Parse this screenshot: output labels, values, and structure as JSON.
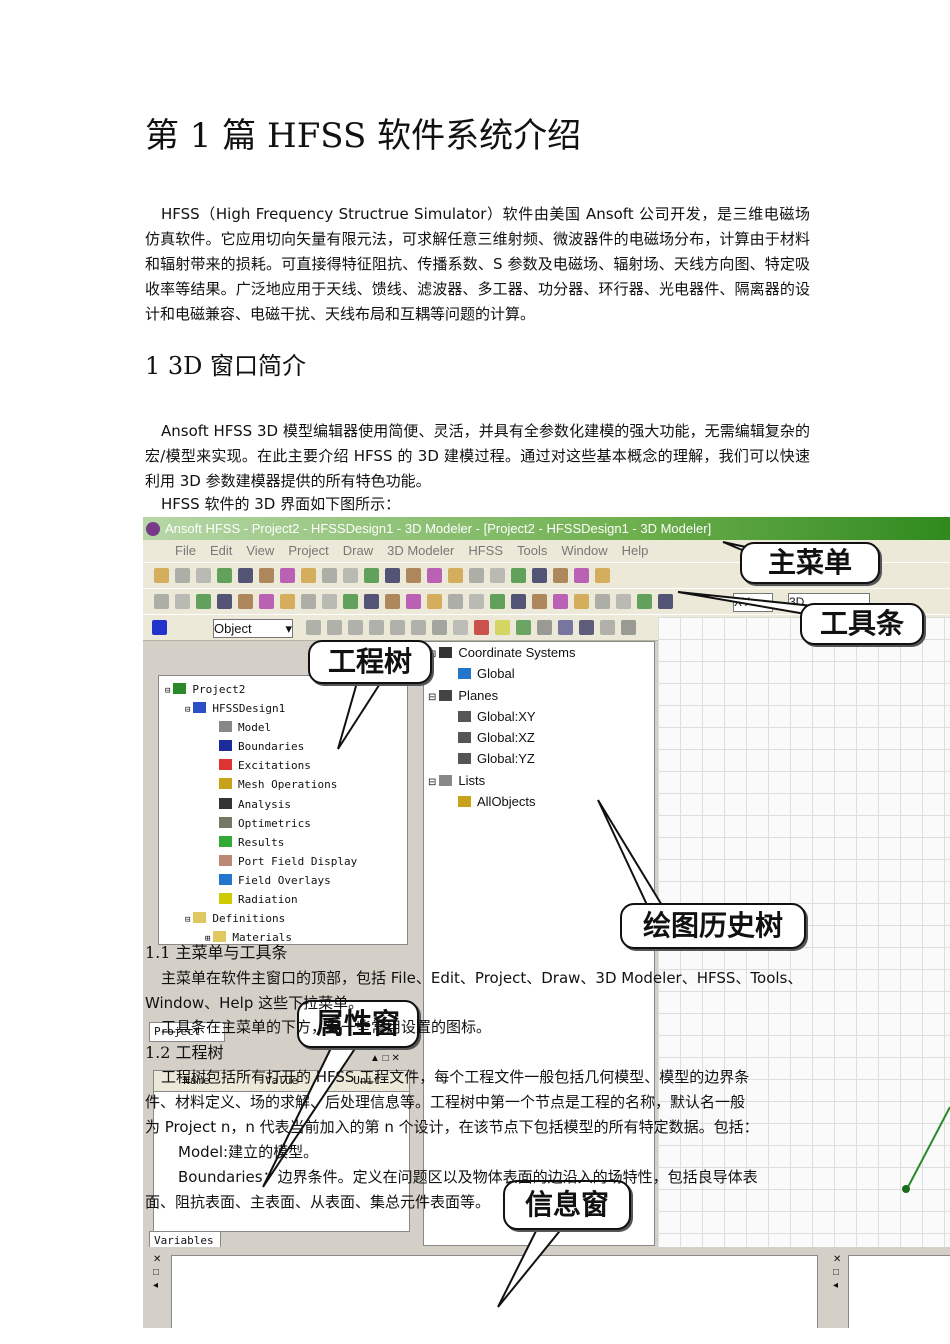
{
  "doc": {
    "title": "第 1 篇  HFSS 软件系统介绍",
    "intro": "HFSS（High Frequency Structrue Simulator）软件由美国 Ansoft 公司开发，是三维电磁场仿真软件。它应用切向矢量有限元法，可求解任意三维射频、微波器件的电磁场分布，计算由于材料和辐射带来的损耗。可直接得特征阻抗、传播系数、S 参数及电磁场、辐射场、天线方向图、特定吸收率等结果。广泛地应用于天线、馈线、滤波器、多工器、功分器、环行器、光电器件、隔离器的设计和电磁兼容、电磁干扰、天线布局和互耦等问题的计算。",
    "section1": "1 3D 窗口简介",
    "section1_para": "Ansoft HFSS 3D 模型编辑器使用简便、灵活，并具有全参数化建模的强大功能，无需编辑复杂的宏/模型来实现。在此主要介绍 HFSS 的 3D 建模过程。通过对这些基本概念的理解，我们可以快速利用 3D 参数建模器提供的所有特色功能。",
    "section1_line2": "HFSS 软件的 3D 界面如下图所示：",
    "sub11": "1.1  主菜单与工具条",
    "sub11_l1": "主菜单在软件主窗口的顶部，包括 File、Edit、Project、Draw、3D Modeler、HFSS、Tools、",
    "sub11_l2": "Window、Help 这些下拉菜单。",
    "sub11_l3": "工具条在主菜单的下方，是一些常用设置的图标。",
    "sub12": "1.2  工程树",
    "sub12_l1": "工程树包括所有打开的 HFSS 工程文件，每个工程文件一般包括几何模型、模型的边界条",
    "sub12_l2": "件、材料定义、场的求解、后处理信息等。工程树中第一个节点是工程的名称，默认名一般",
    "sub12_l3": "为 Project n，n 代表当前加入的第 n 个设计，在该节点下包括模型的所有特定数据。包括：",
    "sub12_l4": "Model:建立的模型。",
    "sub12_l5": "Boundaries：边界条件。定义在问题区以及物体表面的边沿入的场特性，包括良导体表",
    "sub12_l6": "面、阻抗表面、主表面、从表面、集总元件表面等。"
  },
  "app": {
    "window_title": "Ansoft HFSS - Project2 - HFSSDesign1 - 3D Modeler - [Project2 - HFSSDesign1 - 3D Modeler]",
    "menu": [
      "File",
      "Edit",
      "View",
      "Project",
      "Draw",
      "3D Modeler",
      "HFSS",
      "Tools",
      "Window",
      "Help"
    ],
    "select_mode": "Object",
    "plane_select": "XY",
    "view_select": "3D",
    "project_tree": [
      "Project2",
      "HFSSDesign1",
      "Model",
      "Boundaries",
      "Excitations",
      "Mesh Operations",
      "Analysis",
      "Optimetrics",
      "Results",
      "Port Field Display",
      "Field Overlays",
      "Radiation",
      "Definitions",
      "Materials"
    ],
    "history_tree": [
      "Coordinate Systems",
      "Global",
      "Planes",
      "Global:XY",
      "Global:XZ",
      "Global:YZ",
      "Lists",
      "AllObjects"
    ],
    "properties": {
      "tab_project": "Project",
      "col_name": "Name",
      "col_value": "Value",
      "col_unit": "Unit",
      "tab_variables": "Variables"
    },
    "callouts": {
      "menu": "主菜单",
      "toolbar": "工具条",
      "project_tree": "工程树",
      "history_tree": "绘图历史树",
      "properties": "属性窗",
      "message": "信息窗"
    },
    "tree_icon_colors": [
      "#2a8a2a",
      "#2b4fc4",
      "#888",
      "#1b2b9a",
      "#d33",
      "#c9a21c",
      "#333",
      "#776",
      "#3a3",
      "#b87",
      "#27c",
      "#cc0",
      "#e0c860",
      "#e0c860"
    ]
  }
}
